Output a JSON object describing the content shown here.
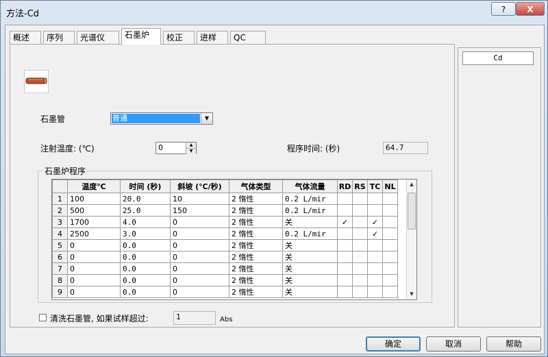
{
  "window": {
    "title": "方法-Cd",
    "help_label": "?",
    "close_label": "X"
  },
  "tabs": [
    {
      "label": "概述"
    },
    {
      "label": "序列"
    },
    {
      "label": "光谱仪"
    },
    {
      "label": "石墨炉"
    },
    {
      "label": "校正"
    },
    {
      "label": "进样"
    },
    {
      "label": "QC"
    }
  ],
  "active_tab": "石墨炉",
  "element": "Cd",
  "form": {
    "tube_label": "石墨管",
    "tube_value": "普通",
    "injection_temp_label": "注射温度: (℃)",
    "injection_temp_value": "0",
    "program_time_label": "程序时间: (秒)",
    "program_time_value": "64.7"
  },
  "program": {
    "group_title": "石墨炉程序",
    "columns": [
      "温度℃",
      "时间 (秒)",
      "斜坡 (℃/秒)",
      "气体类型",
      "气体流量",
      "RD",
      "RS",
      "TC",
      "NL"
    ],
    "rows": [
      {
        "n": "1",
        "temp": "100",
        "time": "20.0",
        "ramp": "10",
        "gas": "2 惰性",
        "flow": "0.2 L/mir",
        "rd": "",
        "rs": "",
        "tc": "",
        "nl": ""
      },
      {
        "n": "2",
        "temp": "500",
        "time": "25.0",
        "ramp": "150",
        "gas": "2 惰性",
        "flow": "0.2 L/mir",
        "rd": "",
        "rs": "",
        "tc": "",
        "nl": ""
      },
      {
        "n": "3",
        "temp": "1700",
        "time": "4.0",
        "ramp": "0",
        "gas": "2 惰性",
        "flow": "关",
        "rd": "✓",
        "rs": "",
        "tc": "✓",
        "nl": ""
      },
      {
        "n": "4",
        "temp": "2500",
        "time": "3.0",
        "ramp": "0",
        "gas": "2 惰性",
        "flow": "0.2 L/mir",
        "rd": "",
        "rs": "",
        "tc": "✓",
        "nl": ""
      },
      {
        "n": "5",
        "temp": "0",
        "time": "0.0",
        "ramp": "0",
        "gas": "2 惰性",
        "flow": "关",
        "rd": "",
        "rs": "",
        "tc": "",
        "nl": ""
      },
      {
        "n": "6",
        "temp": "0",
        "time": "0.0",
        "ramp": "0",
        "gas": "2 惰性",
        "flow": "关",
        "rd": "",
        "rs": "",
        "tc": "",
        "nl": ""
      },
      {
        "n": "7",
        "temp": "0",
        "time": "0.0",
        "ramp": "0",
        "gas": "2 惰性",
        "flow": "关",
        "rd": "",
        "rs": "",
        "tc": "",
        "nl": ""
      },
      {
        "n": "8",
        "temp": "0",
        "time": "0.0",
        "ramp": "0",
        "gas": "2 惰性",
        "flow": "关",
        "rd": "",
        "rs": "",
        "tc": "",
        "nl": ""
      },
      {
        "n": "9",
        "temp": "0",
        "time": "0.0",
        "ramp": "0",
        "gas": "2 惰性",
        "flow": "关",
        "rd": "",
        "rs": "",
        "tc": "",
        "nl": ""
      }
    ]
  },
  "clean": {
    "label": "清洗石墨管, 如果试样超过:",
    "value": "1",
    "unit": "Abs",
    "checked": false
  },
  "buttons": {
    "ok": "确定",
    "cancel": "取消",
    "help": "帮助"
  },
  "icons": {
    "furnace": "graphite-tube-icon",
    "dropdown": "chevron-down-icon"
  }
}
